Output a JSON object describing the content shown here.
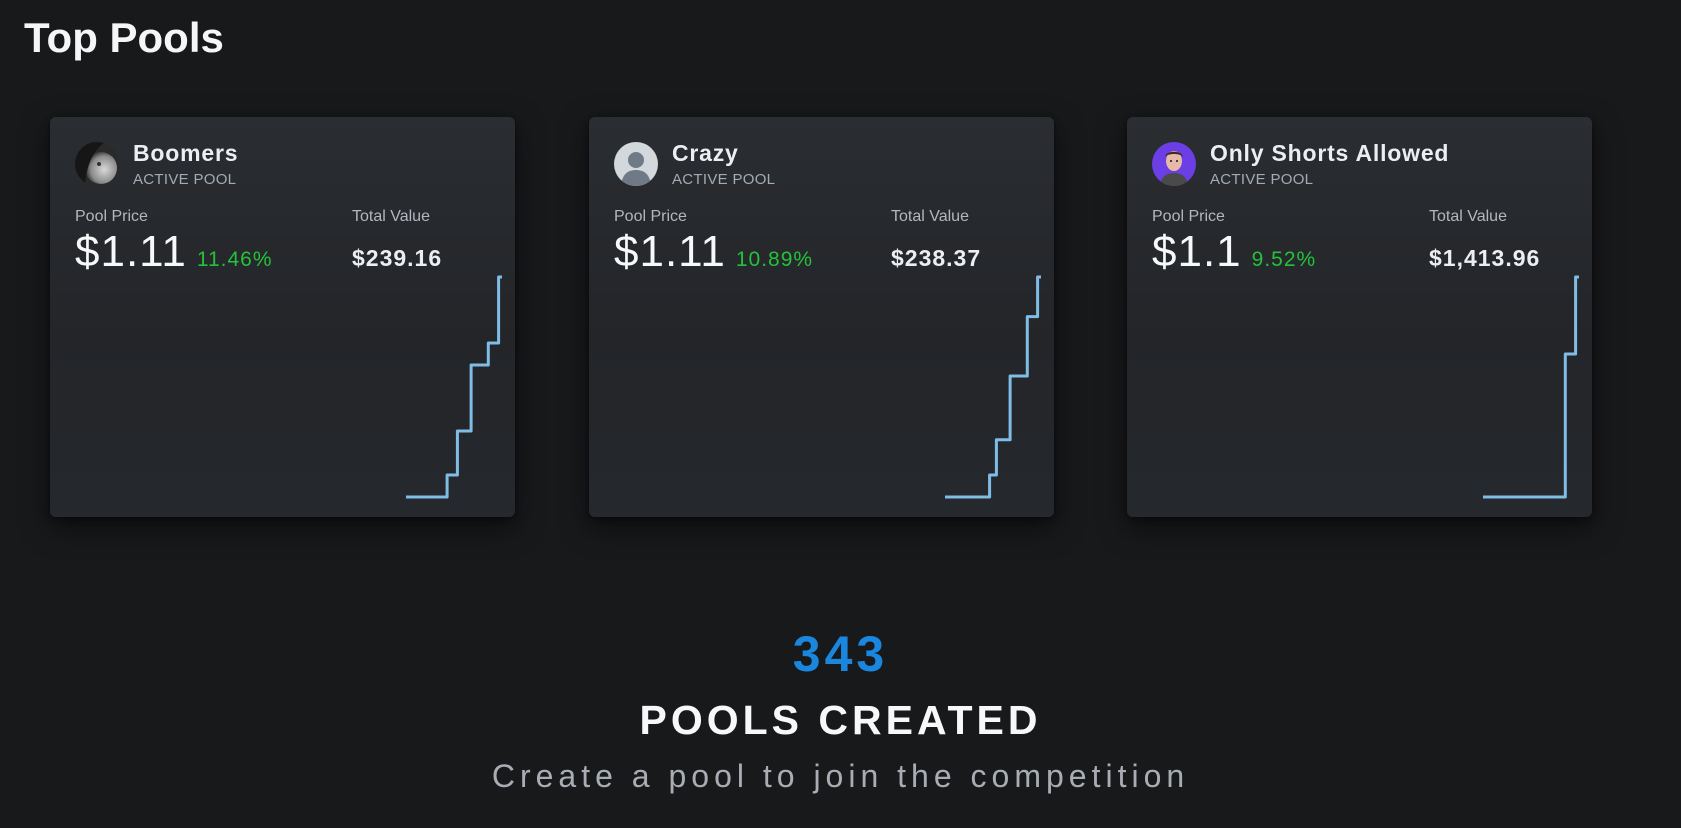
{
  "header": {
    "title": "Top Pools"
  },
  "pools": [
    {
      "name": "Boomers",
      "status": "ACTIVE POOL",
      "price_label": "Pool Price",
      "price": "$1.11",
      "change": "11.46%",
      "value_label": "Total Value",
      "total_value": "$239.16",
      "avatar_icon": "user-photo-icon",
      "sparkline": [
        0,
        0,
        0,
        0,
        0,
        0,
        0,
        0,
        0,
        0,
        0,
        0,
        1,
        1,
        1,
        3,
        3,
        3,
        3,
        6,
        6,
        6,
        6,
        6,
        7,
        7,
        7,
        10,
        10
      ]
    },
    {
      "name": "Crazy",
      "status": "ACTIVE POOL",
      "price_label": "Pool Price",
      "price": "$1.11",
      "change": "10.89%",
      "value_label": "Total Value",
      "total_value": "$238.37",
      "avatar_icon": "default-user-icon",
      "sparkline": [
        0,
        0,
        0,
        0,
        0,
        0,
        0,
        0,
        0,
        0,
        0,
        0,
        0,
        1,
        1,
        2.6,
        2.6,
        2.6,
        2.6,
        5.5,
        5.5,
        5.5,
        5.5,
        5.5,
        8.2,
        8.2,
        8.2,
        10,
        10
      ]
    },
    {
      "name": "Only Shorts Allowed",
      "status": "ACTIVE POOL",
      "price_label": "Pool Price",
      "price": "$1.1",
      "change": "9.52%",
      "value_label": "Total Value",
      "total_value": "$1,413.96",
      "avatar_icon": "user-photo-icon",
      "sparkline": [
        0,
        0,
        0,
        0,
        0,
        0,
        0,
        0,
        0,
        0,
        0,
        0,
        0,
        0,
        0,
        0,
        0,
        0,
        0,
        0,
        0,
        0,
        0,
        0,
        6.5,
        6.5,
        6.5,
        10,
        10
      ]
    }
  ],
  "stats": {
    "count": "343",
    "label": "POOLS CREATED",
    "subtitle": "Create a pool to join the competition"
  },
  "colors": {
    "background": "#18191b",
    "positive": "#25c13a",
    "accent": "#1a86dd",
    "sparkline": "#7fbde7"
  }
}
